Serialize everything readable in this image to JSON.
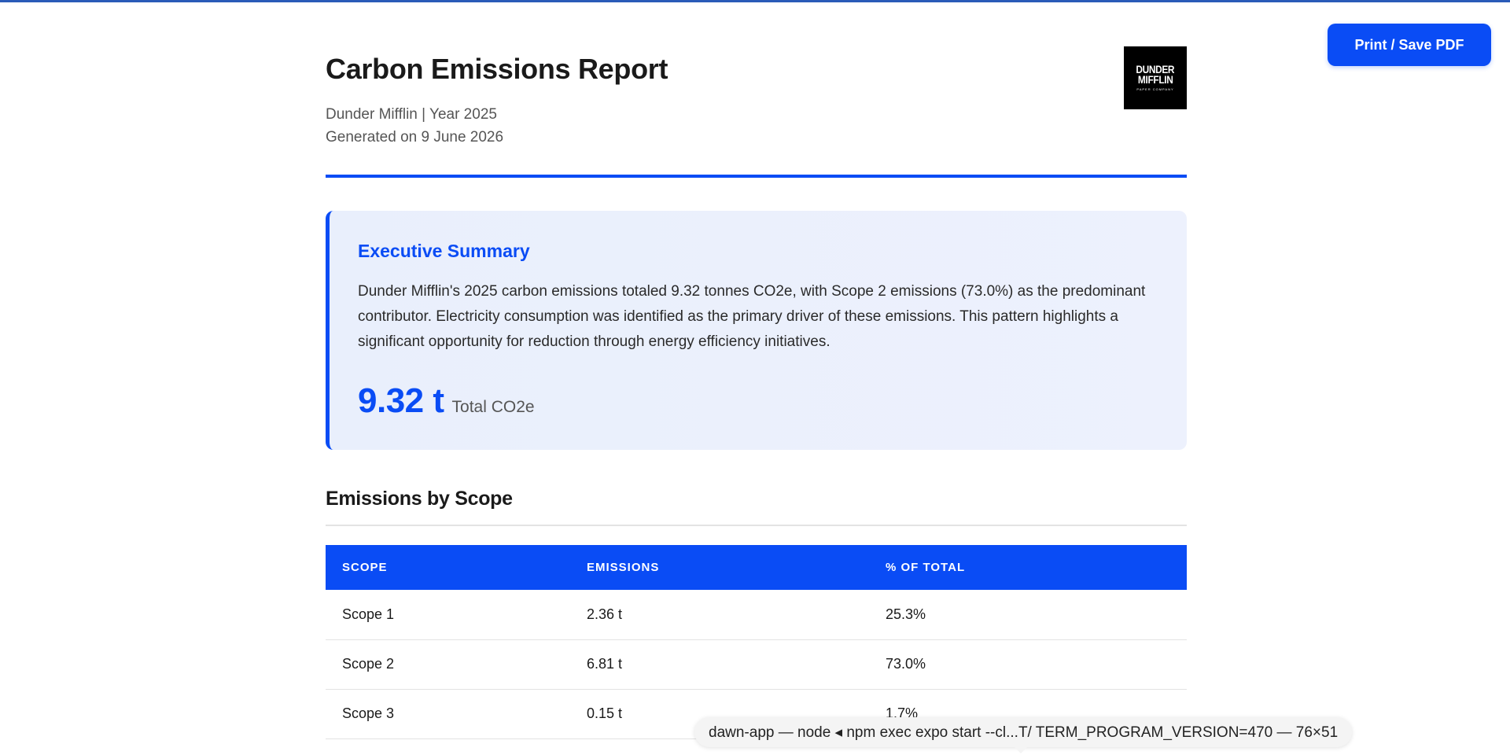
{
  "toolbar": {
    "print_label": "Print / Save PDF"
  },
  "header": {
    "title": "Carbon Emissions Report",
    "company_year": "Dunder Mifflin | Year 2025",
    "generated": "Generated on 9 June 2026",
    "logo": {
      "line1": "DUNDER",
      "line2": "MIFFLIN",
      "line3": "PAPER COMPANY"
    }
  },
  "summary": {
    "heading": "Executive Summary",
    "text": "Dunder Mifflin's 2025 carbon emissions totaled 9.32 tonnes CO2e, with Scope 2 emissions (73.0%) as the predominant contributor. Electricity consumption was identified as the primary driver of these emissions. This pattern highlights a significant opportunity for reduction through energy efficiency initiatives.",
    "kpi_value": "9.32 t",
    "kpi_label": "Total CO2e"
  },
  "scope_section": {
    "title": "Emissions by Scope",
    "columns": [
      "SCOPE",
      "EMISSIONS",
      "% OF TOTAL"
    ],
    "rows": [
      [
        "Scope 1",
        "2.36 t",
        "25.3%"
      ],
      [
        "Scope 2",
        "6.81 t",
        "73.0%"
      ],
      [
        "Scope 3",
        "0.15 t",
        "1.7%"
      ]
    ]
  },
  "tooltip": {
    "text": "dawn-app — node ◂ npm exec expo start --cl...T/ TERM_PROGRAM_VERSION=470 — 76×51"
  },
  "colors": {
    "accent": "#0a4cf5",
    "summary_bg": "#e9effc",
    "frame_top": "#2a5bb8"
  }
}
